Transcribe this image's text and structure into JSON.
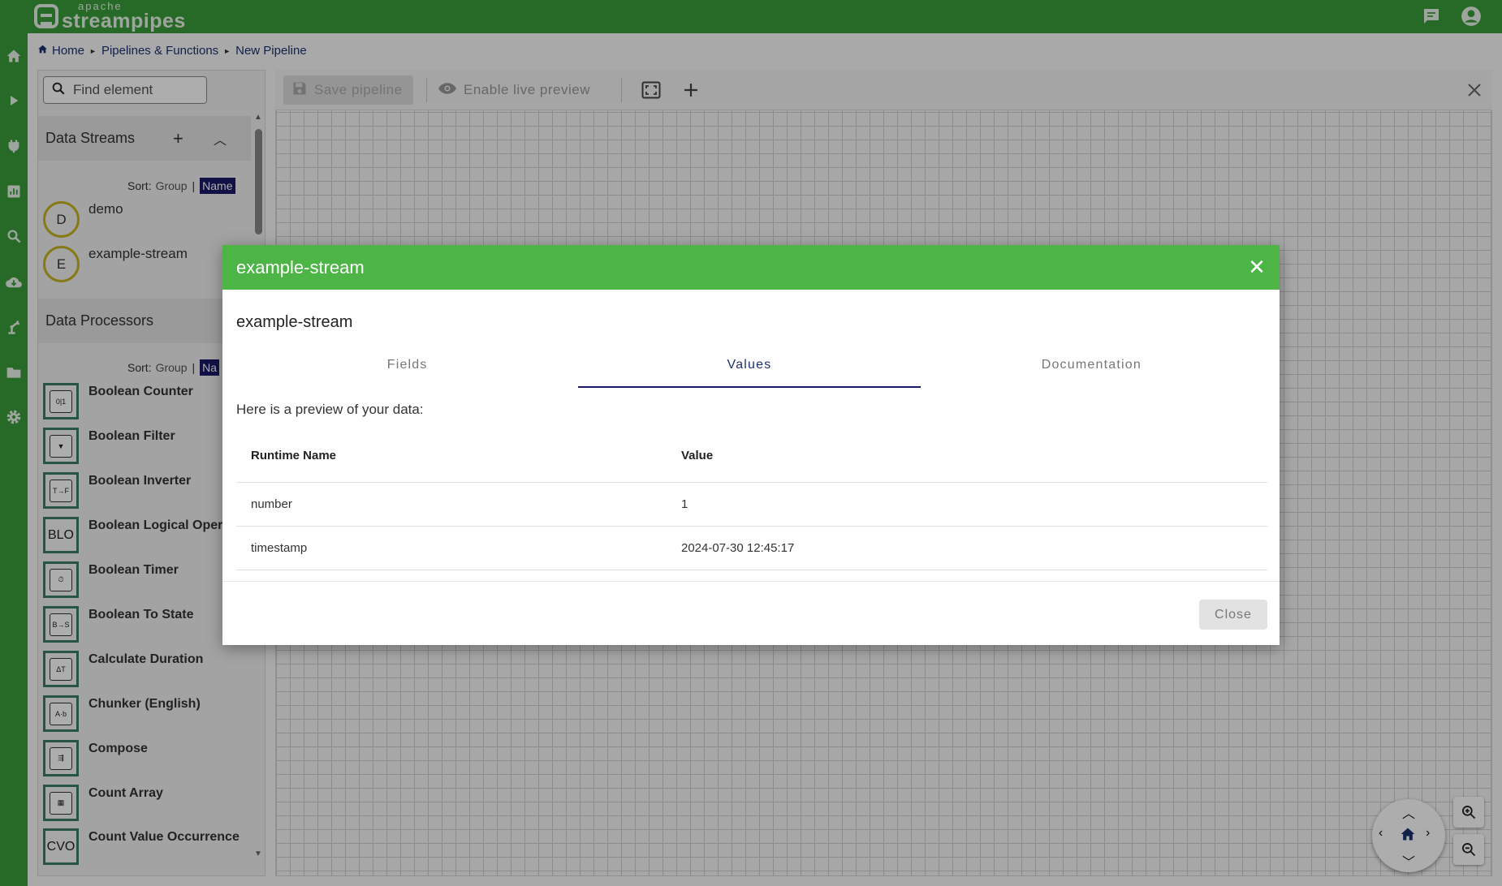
{
  "app": {
    "logo_small": "apache",
    "logo_big": "streampipes",
    "brand_color": "#3a9c3a",
    "dialog_header_color": "#4cb545"
  },
  "topbar": {
    "icons": [
      "chat-icon",
      "account-icon"
    ]
  },
  "rail": {
    "icons": [
      "home-icon",
      "play-icon",
      "plug-icon",
      "chart-icon",
      "search-icon",
      "cloud-icon",
      "robot-arm-icon",
      "folder-icon",
      "settings-icon"
    ]
  },
  "breadcrumb": {
    "items": [
      "Home",
      "Pipelines & Functions",
      "New Pipeline"
    ]
  },
  "left_panel": {
    "search": {
      "placeholder": "Find element"
    },
    "data_streams": {
      "title": "Data Streams",
      "sort_label": "Sort:",
      "sort_group": "Group",
      "sort_separator": "|",
      "sort_name": "Name",
      "items": [
        {
          "letter": "D",
          "label": "demo"
        },
        {
          "letter": "E",
          "label": "example-stream"
        }
      ]
    },
    "data_processors": {
      "title": "Data Processors",
      "sort_label": "Sort:",
      "sort_group": "Group",
      "sort_separator": "|",
      "sort_name": "Na",
      "items": [
        {
          "icon": "boolean-counter-icon",
          "glyph": "0|1",
          "label": "Boolean Counter"
        },
        {
          "icon": "boolean-filter-icon",
          "glyph": "▼",
          "label": "Boolean Filter"
        },
        {
          "icon": "boolean-inverter-icon",
          "glyph": "T→F",
          "label": "Boolean Inverter"
        },
        {
          "icon": "text-badge",
          "glyph": "BLO",
          "label": "Boolean Logical Opera"
        },
        {
          "icon": "boolean-timer-icon",
          "glyph": "⏱",
          "label": "Boolean Timer"
        },
        {
          "icon": "boolean-to-state-icon",
          "glyph": "B→S",
          "label": "Boolean To State"
        },
        {
          "icon": "calculate-duration-icon",
          "glyph": "ΔT",
          "label": "Calculate Duration"
        },
        {
          "icon": "chunker-icon",
          "glyph": "A·b",
          "label": "Chunker (English)"
        },
        {
          "icon": "compose-icon",
          "glyph": "⇶",
          "label": "Compose"
        },
        {
          "icon": "count-array-icon",
          "glyph": "▦",
          "label": "Count Array"
        },
        {
          "icon": "text-badge",
          "glyph": "CVO",
          "label": "Count Value Occurrence"
        }
      ]
    }
  },
  "toolbar": {
    "save_label": "Save pipeline",
    "preview_label": "Enable live preview"
  },
  "dialog": {
    "header": "example-stream",
    "title": "example-stream",
    "tabs": [
      "Fields",
      "Values",
      "Documentation"
    ],
    "active_tab": "Values",
    "preview_text": "Here is a preview of your data:",
    "table": {
      "headers": [
        "Runtime Name",
        "Value"
      ],
      "rows": [
        [
          "number",
          "1"
        ],
        [
          "timestamp",
          "2024-07-30 12:45:17"
        ]
      ]
    },
    "close_label": "Close"
  }
}
